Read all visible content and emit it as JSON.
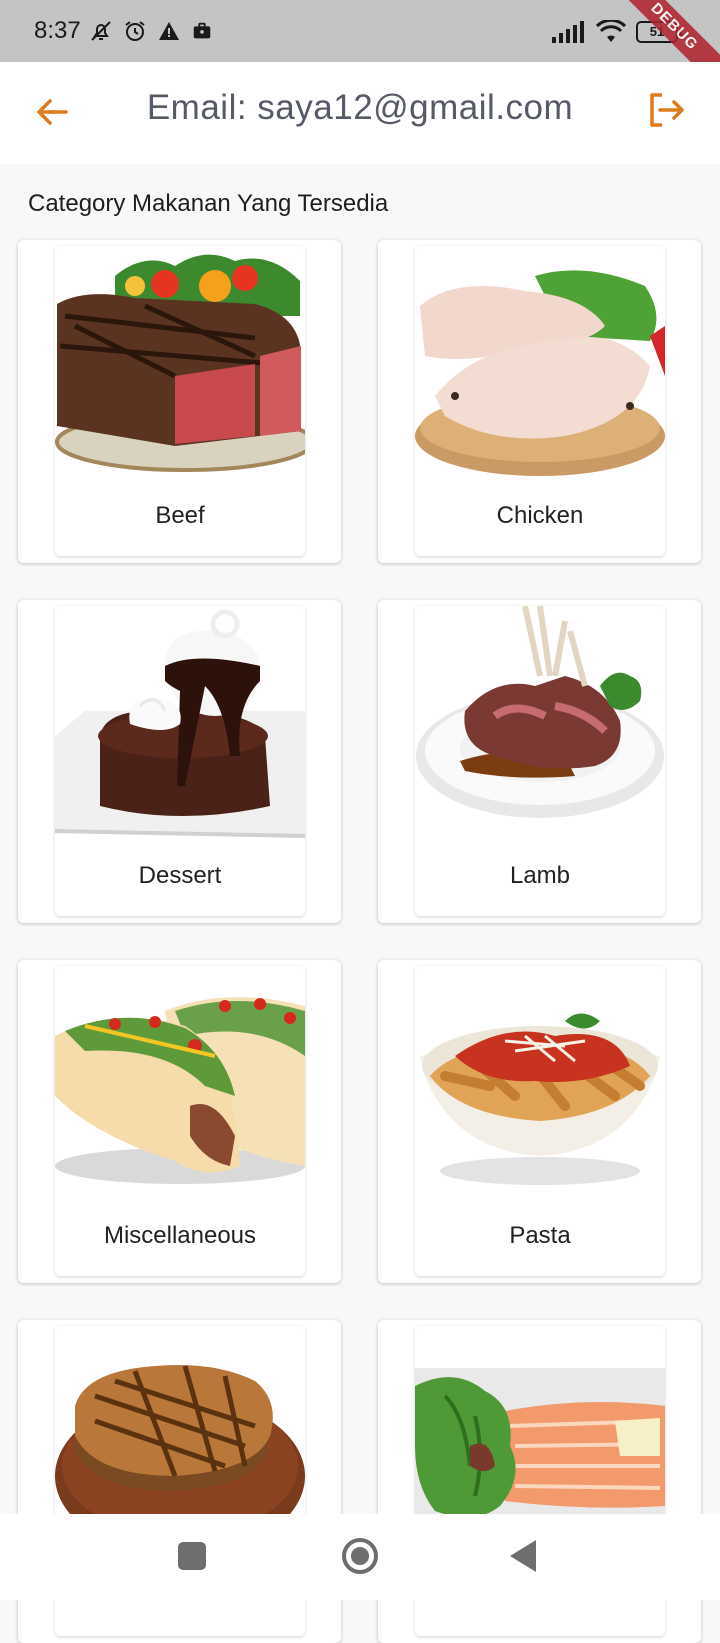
{
  "status_bar": {
    "time": "8:37",
    "battery": "51"
  },
  "debug_ribbon": "DEBUG",
  "app_bar": {
    "title": "Email: saya12@gmail.com"
  },
  "section_title": "Category Makanan Yang Tersedia",
  "categories": [
    {
      "label": "Beef",
      "image": "beef-steak-photo"
    },
    {
      "label": "Chicken",
      "image": "raw-chicken-photo"
    },
    {
      "label": "Dessert",
      "image": "chocolate-lava-cake-photo"
    },
    {
      "label": "Lamb",
      "image": "lamb-chops-photo"
    },
    {
      "label": "Miscellaneous",
      "image": "tacos-photo"
    },
    {
      "label": "Pasta",
      "image": "penne-pasta-photo"
    },
    {
      "label": "",
      "image": "grilled-pork-chop-photo"
    },
    {
      "label": "",
      "image": "salmon-salad-photo"
    }
  ],
  "colors": {
    "accent": "#e07b1a",
    "title_text": "#555a66",
    "status_bar": "#c4c4c4",
    "background": "#f8f8f8"
  }
}
